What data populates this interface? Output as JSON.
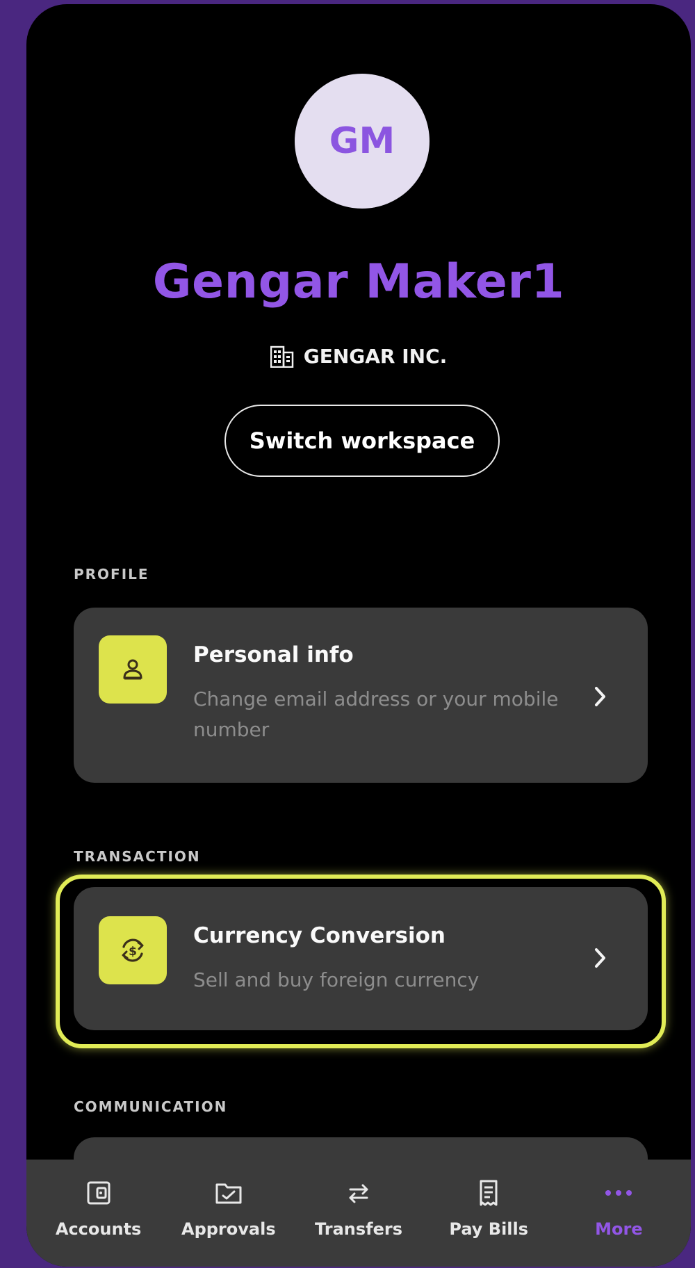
{
  "profile": {
    "initials": "GM",
    "name": "Gengar Maker1",
    "company": "GENGAR INC.",
    "company_icon": "building-icon",
    "switch_label": "Switch workspace"
  },
  "sections": {
    "profile_label": "PROFILE",
    "transaction_label": "TRANSACTION",
    "communication_label": "COMMUNICATION"
  },
  "cards": {
    "personal_info": {
      "title": "Personal info",
      "subtitle": "Change email address or your mobile number",
      "icon": "user-icon"
    },
    "currency_conversion": {
      "title": "Currency Conversion",
      "subtitle": "Sell and buy foreign currency",
      "icon": "currency-exchange-icon"
    }
  },
  "tabbar": {
    "tabs": [
      {
        "label": "Accounts",
        "icon": "wallet-icon"
      },
      {
        "label": "Approvals",
        "icon": "folder-check-icon"
      },
      {
        "label": "Transfers",
        "icon": "transfer-arrows-icon"
      },
      {
        "label": "Pay Bills",
        "icon": "receipt-icon"
      },
      {
        "label": "More",
        "icon": "more-dots-icon",
        "active": true
      }
    ]
  },
  "colors": {
    "background": "#4a2780",
    "accent_purple": "#9256e6",
    "accent_yellow": "#dde34c",
    "card": "#3a3a3a"
  }
}
